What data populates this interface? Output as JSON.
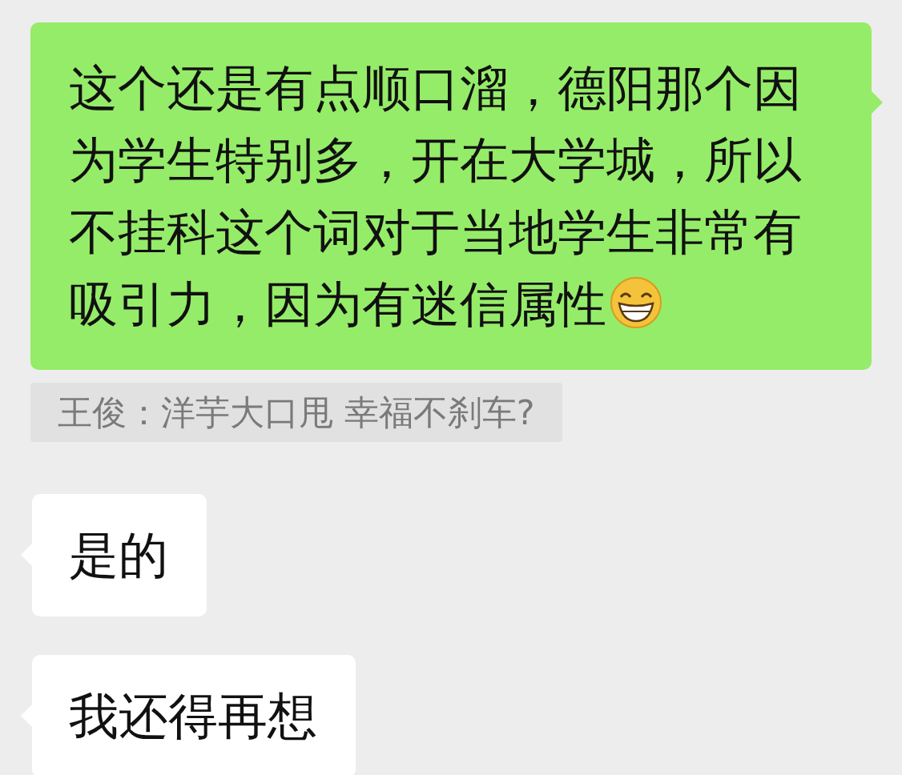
{
  "messages": [
    {
      "kind": "outgoing",
      "text": "这个还是有点顺口溜，德阳那个因为学生特别多，开在大学城，所以不挂科这个词对于当地学生非常有吸引力，因为有迷信属性",
      "emoji": true
    },
    {
      "kind": "quote",
      "text": "王俊：洋芋大口甩 幸福不刹车?"
    },
    {
      "kind": "incoming",
      "text": "是的"
    },
    {
      "kind": "incoming",
      "text": "我还得再想"
    }
  ]
}
